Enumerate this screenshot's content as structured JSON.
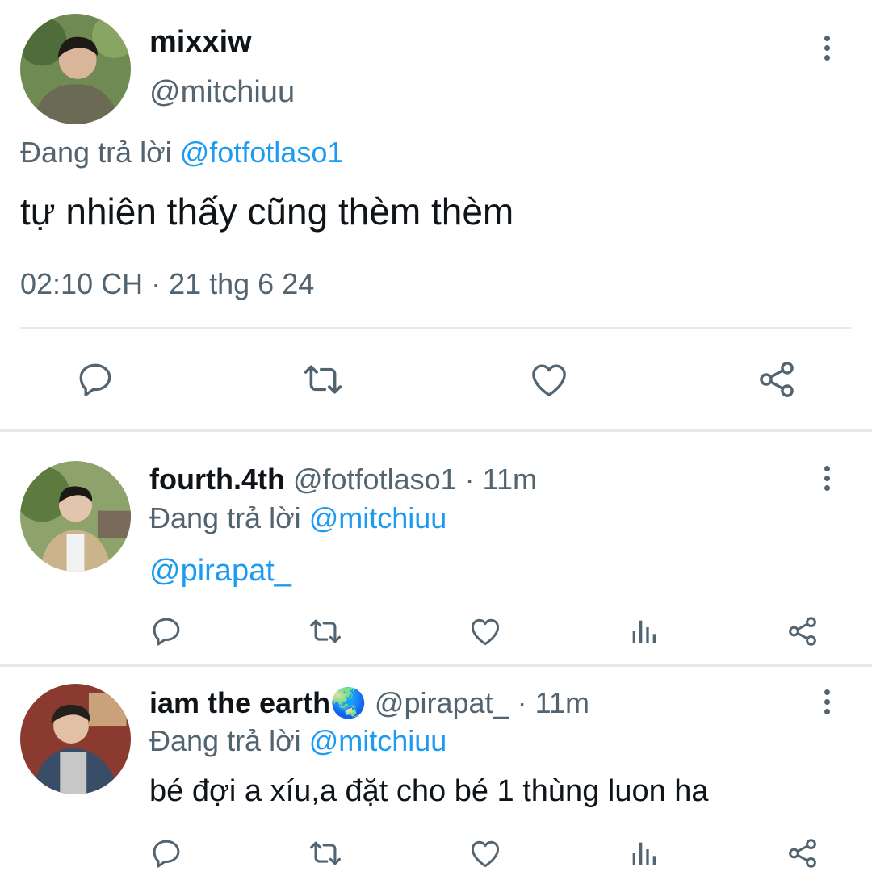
{
  "main_tweet": {
    "display_name": "mixxiw",
    "handle": "@mitchiuu",
    "replying_prefix": "Đang trả lời",
    "replying_to": "@fotfotlaso1",
    "text": "tự nhiên thấy cũng thèm thèm",
    "timestamp": "02:10 CH · 21 thg 6 24",
    "actions": [
      "reply-icon",
      "retweet-icon",
      "like-icon",
      "share-icon"
    ]
  },
  "replies": [
    {
      "display_name": "fourth.4th",
      "handle": "@fotfotlaso1",
      "time": "· 11m",
      "replying_prefix": "Đang trả lời",
      "replying_to": "@mitchiuu",
      "text": "@pirapat_",
      "actions": [
        "reply-icon",
        "retweet-icon",
        "like-icon",
        "analytics-icon",
        "share-icon"
      ]
    },
    {
      "display_name": "iam the earth",
      "display_name_emoji": "🌏",
      "handle": "@pirapat_",
      "time": "· 11m",
      "replying_prefix": "Đang trả lời",
      "replying_to": "@mitchiuu",
      "text": "bé đợi a xíu,a đặt cho bé 1 thùng luon ha",
      "actions": [
        "reply-icon",
        "retweet-icon",
        "like-icon",
        "analytics-icon",
        "share-icon"
      ]
    }
  ],
  "colors": {
    "text": "#0f1419",
    "secondary": "#536471",
    "link": "#1d9bf0",
    "divider": "#e6e9ec"
  }
}
